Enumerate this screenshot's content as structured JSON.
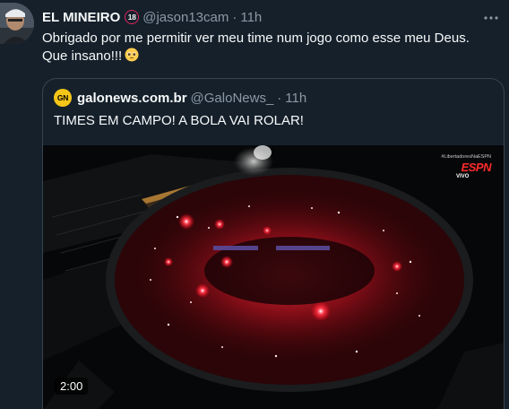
{
  "tweet": {
    "display_name": "EL MINEIRO",
    "age_badge": "18",
    "handle": "@jason13cam",
    "separator": "·",
    "time": "11h",
    "text_line1": "Obrigado por me permitir ver meu time num jogo como esse meu Deus.",
    "text_line2": "Que insano!!!",
    "emoji": "pleading-face-icon"
  },
  "quote": {
    "display_name": "galonews.com.br",
    "logo_text": "GN",
    "handle": "@GaloNews_",
    "separator": "·",
    "time": "11h",
    "text": "TIMES EM CAMPO! A BOLA VAI ROLAR!",
    "media": {
      "hashtag": "#LibertadoresNaESPN",
      "channel": "ESPN",
      "live": "VIVO",
      "duration": "2:00"
    }
  },
  "colors": {
    "background": "#15202b",
    "primary_text": "#f7f9f9",
    "secondary_text": "#8b98a5",
    "border": "#38444d",
    "flare_red": "#ff2030"
  }
}
